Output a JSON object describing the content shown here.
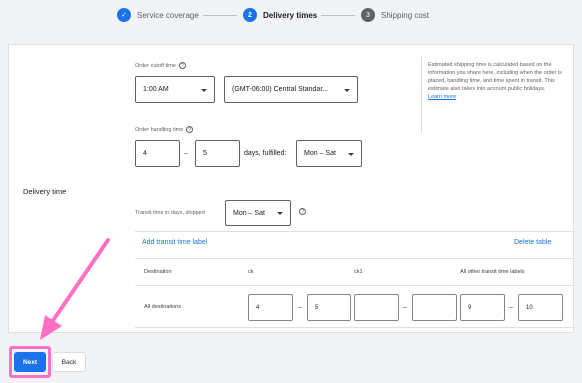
{
  "stepper": {
    "steps": [
      {
        "number": "✓",
        "label": "Service coverage",
        "state": "done"
      },
      {
        "number": "2",
        "label": "Delivery times",
        "state": "active"
      },
      {
        "number": "3",
        "label": "Shipping cost",
        "state": "todo"
      }
    ]
  },
  "delivery": {
    "section_label": "Delivery time",
    "cutoff": {
      "label": "Order cutoff time",
      "time": "1:00 AM",
      "timezone": "(GMT-06:00) Central Standar..."
    },
    "handling": {
      "label": "Order handling time",
      "min": "4",
      "max": "5",
      "suffix": "days, fulfilled:",
      "days": "Mon – Sat"
    },
    "transit": {
      "label": "Transit time in days, shipped",
      "days": "Mon – Sat"
    },
    "info": {
      "text": "Estimated shipping time is calculated based on the information you share here, including when the order is placed, handling time, and time spent in transit. This estimate also takes into account public holidays.",
      "link": "Learn more"
    },
    "table": {
      "add_label": "Add transit time label",
      "delete_label": "Delete table",
      "headers": [
        "Destination",
        "ck",
        "ck1",
        "All other transit time labels"
      ],
      "row": {
        "destination": "All destinations",
        "ck_min": "4",
        "ck_max": "5",
        "ck1_min": "",
        "ck1_max": "",
        "other_min": "9",
        "other_max": "10"
      }
    }
  },
  "footer": {
    "next": "Next",
    "back": "Back"
  },
  "colors": {
    "accent": "#1a73e8",
    "highlight": "#ff6fc4"
  }
}
